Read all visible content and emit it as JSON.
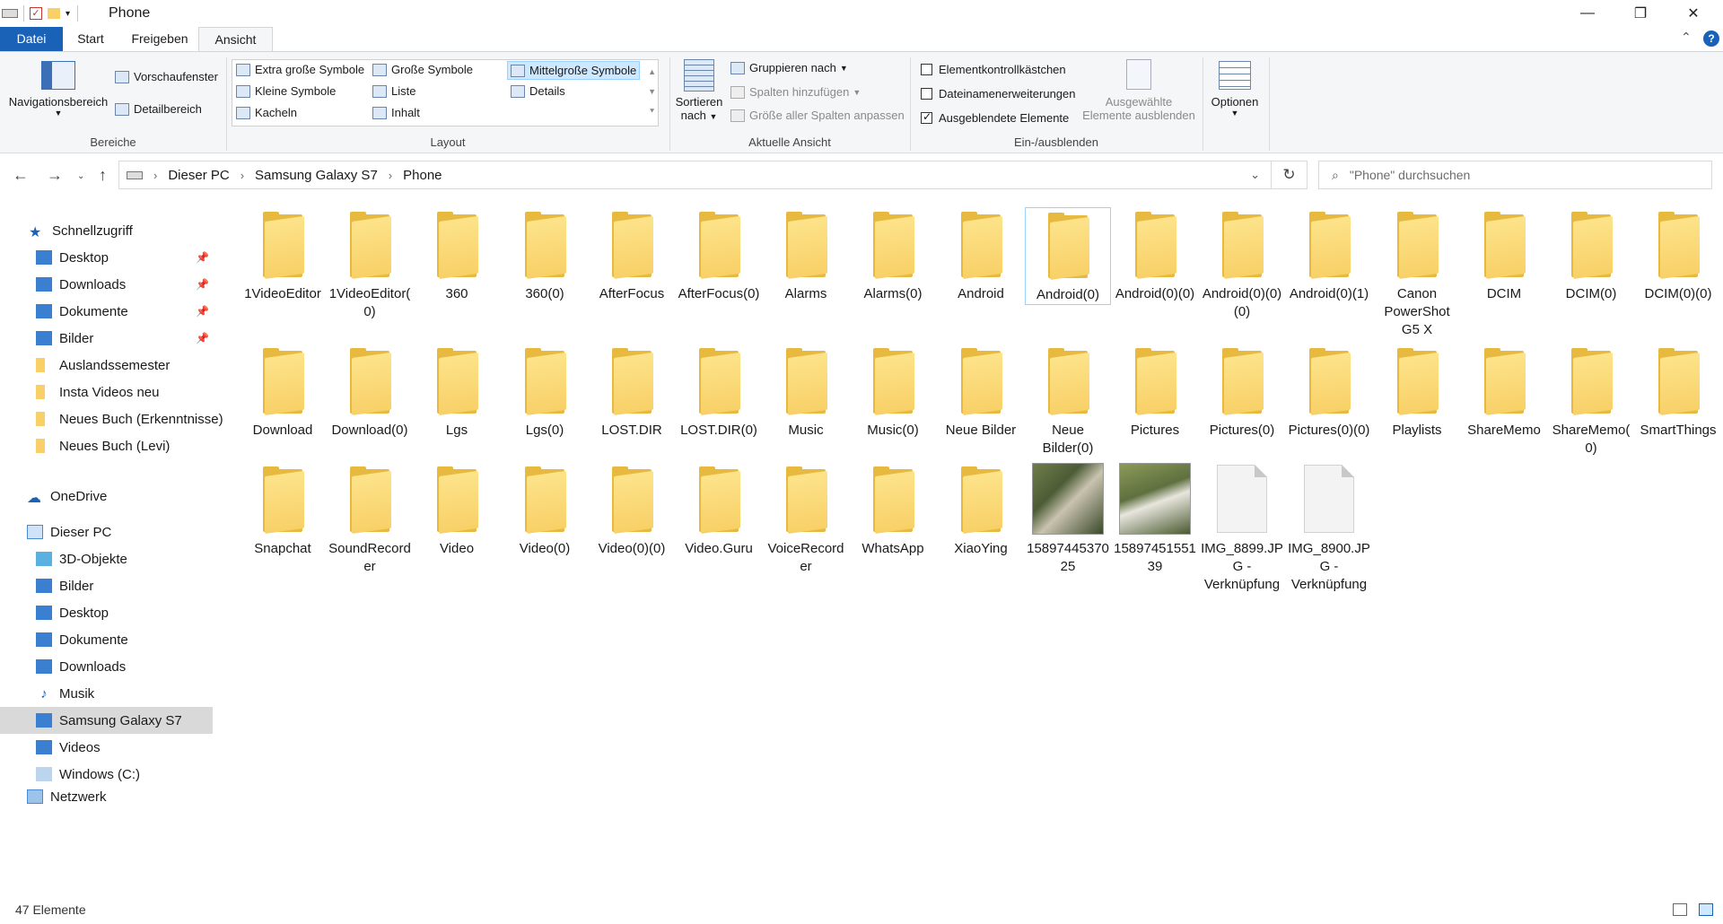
{
  "window": {
    "title": "Phone",
    "controls": {
      "minimize": "—",
      "maximize": "❐",
      "close": "✕"
    }
  },
  "ribbon_tabs": [
    {
      "label": "Datei"
    },
    {
      "label": "Start"
    },
    {
      "label": "Freigeben"
    },
    {
      "label": "Ansicht"
    }
  ],
  "ribbon": {
    "bereiche": {
      "label": "Bereiche",
      "navigationsbereich": "Navigationsbereich",
      "vorschaufenster": "Vorschaufenster",
      "detailbereich": "Detailbereich"
    },
    "layout": {
      "label": "Layout",
      "items": [
        {
          "label": "Extra große Symbole"
        },
        {
          "label": "Große Symbole"
        },
        {
          "label": "Mittelgroße Symbole"
        },
        {
          "label": "Kleine Symbole"
        },
        {
          "label": "Liste"
        },
        {
          "label": "Details"
        },
        {
          "label": "Kacheln"
        },
        {
          "label": "Inhalt"
        }
      ],
      "selected": "Mittelgroße Symbole"
    },
    "aktuelle_ansicht": {
      "label": "Aktuelle Ansicht",
      "sortieren": "Sortieren",
      "sortieren2": "nach",
      "gruppieren": "Gruppieren nach",
      "spalten": "Spalten hinzufügen",
      "groesse": "Größe aller Spalten anpassen"
    },
    "ein_ausblenden": {
      "label": "Ein-/ausblenden",
      "elementkontroll": "Elementkontrollkästchen",
      "dateinamen": "Dateinamenerweiterungen",
      "ausgeblendete": "Ausgeblendete Elemente",
      "ausgewaehlte1": "Ausgewählte",
      "ausgewaehlte2": "Elemente ausblenden",
      "checked": {
        "elementkontroll": false,
        "dateinamen": false,
        "ausgeblendete": true
      }
    },
    "optionen": "Optionen"
  },
  "address": {
    "crumbs": [
      "Dieser PC",
      "Samsung Galaxy S7",
      "Phone"
    ],
    "search_placeholder": "\"Phone\" durchsuchen"
  },
  "navpane": {
    "schnellzugriff": "Schnellzugriff",
    "quick": [
      {
        "label": "Desktop",
        "pinned": true
      },
      {
        "label": "Downloads",
        "pinned": true
      },
      {
        "label": "Dokumente",
        "pinned": true
      },
      {
        "label": "Bilder",
        "pinned": true
      },
      {
        "label": "Auslandssemester",
        "pinned": false
      },
      {
        "label": "Insta Videos neu",
        "pinned": false
      },
      {
        "label": "Neues Buch (Erkenntnisse)",
        "pinned": false
      },
      {
        "label": "Neues Buch (Levi)",
        "pinned": false
      }
    ],
    "onedrive": "OneDrive",
    "dieser_pc": "Dieser PC",
    "pc": [
      {
        "label": "3D-Objekte"
      },
      {
        "label": "Bilder"
      },
      {
        "label": "Desktop"
      },
      {
        "label": "Dokumente"
      },
      {
        "label": "Downloads"
      },
      {
        "label": "Musik"
      },
      {
        "label": "Samsung Galaxy S7"
      },
      {
        "label": "Videos"
      },
      {
        "label": "Windows (C:)"
      }
    ],
    "netzwerk": "Netzwerk"
  },
  "items": [
    {
      "name": "1VideoEditor",
      "type": "folder"
    },
    {
      "name": "1VideoEditor(0)",
      "type": "folder"
    },
    {
      "name": "360",
      "type": "folder"
    },
    {
      "name": "360(0)",
      "type": "folder"
    },
    {
      "name": "AfterFocus",
      "type": "folder"
    },
    {
      "name": "AfterFocus(0)",
      "type": "folder"
    },
    {
      "name": "Alarms",
      "type": "folder"
    },
    {
      "name": "Alarms(0)",
      "type": "folder"
    },
    {
      "name": "Android",
      "type": "folder"
    },
    {
      "name": "Android(0)",
      "type": "folder"
    },
    {
      "name": "Android(0)(0)",
      "type": "folder"
    },
    {
      "name": "Android(0)(0)(0)",
      "type": "folder"
    },
    {
      "name": "Android(0)(1)",
      "type": "folder"
    },
    {
      "name": "Canon PowerShot G5 X",
      "type": "folder"
    },
    {
      "name": "DCIM",
      "type": "folder"
    },
    {
      "name": "DCIM(0)",
      "type": "folder"
    },
    {
      "name": "DCIM(0)(0)",
      "type": "folder"
    },
    {
      "name": "Download",
      "type": "folder"
    },
    {
      "name": "Download(0)",
      "type": "folder"
    },
    {
      "name": "Lgs",
      "type": "folder"
    },
    {
      "name": "Lgs(0)",
      "type": "folder"
    },
    {
      "name": "LOST.DIR",
      "type": "folder"
    },
    {
      "name": "LOST.DIR(0)",
      "type": "folder"
    },
    {
      "name": "Music",
      "type": "folder"
    },
    {
      "name": "Music(0)",
      "type": "folder"
    },
    {
      "name": "Neue Bilder",
      "type": "folder"
    },
    {
      "name": "Neue Bilder(0)",
      "type": "folder"
    },
    {
      "name": "Pictures",
      "type": "folder"
    },
    {
      "name": "Pictures(0)",
      "type": "folder"
    },
    {
      "name": "Pictures(0)(0)",
      "type": "folder"
    },
    {
      "name": "Playlists",
      "type": "folder"
    },
    {
      "name": "ShareMemo",
      "type": "folder"
    },
    {
      "name": "ShareMemo(0)",
      "type": "folder"
    },
    {
      "name": "SmartThings",
      "type": "folder"
    },
    {
      "name": "Snapchat",
      "type": "folder"
    },
    {
      "name": "SoundRecorder",
      "type": "folder"
    },
    {
      "name": "Video",
      "type": "folder"
    },
    {
      "name": "Video(0)",
      "type": "folder"
    },
    {
      "name": "Video(0)(0)",
      "type": "folder"
    },
    {
      "name": "Video.Guru",
      "type": "folder"
    },
    {
      "name": "VoiceRecorder",
      "type": "folder"
    },
    {
      "name": "WhatsApp",
      "type": "folder"
    },
    {
      "name": "XiaoYing",
      "type": "folder"
    },
    {
      "name": "1589744537025",
      "type": "image"
    },
    {
      "name": "1589745155139",
      "type": "image"
    },
    {
      "name": "IMG_8899.JPG - Verknüpfung",
      "type": "shortcut"
    },
    {
      "name": "IMG_8900.JPG - Verknüpfung",
      "type": "shortcut"
    }
  ],
  "status": {
    "count": "47 Elemente"
  },
  "colors": {
    "accent": "#1a62b8",
    "selection": "#cde8ff",
    "folder": "#f8d067"
  }
}
